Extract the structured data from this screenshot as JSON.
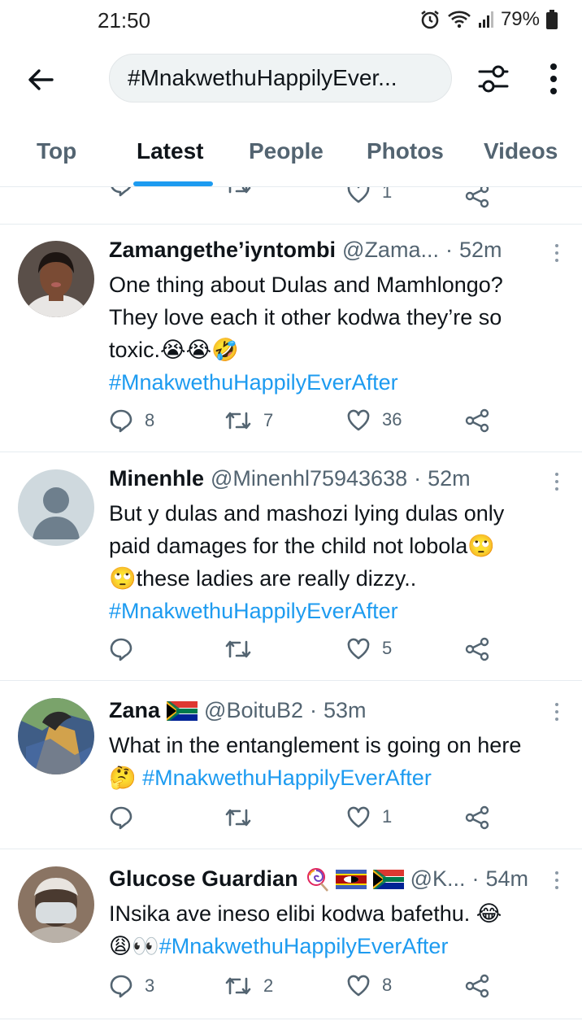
{
  "status_bar": {
    "time": "21:50",
    "battery": "79%"
  },
  "top_bar": {
    "search_query": "#MnakwethuHappilyEver..."
  },
  "tabs": [
    {
      "label": "Top"
    },
    {
      "label": "Latest"
    },
    {
      "label": "People"
    },
    {
      "label": "Photos"
    },
    {
      "label": "Videos"
    }
  ],
  "partial_tweet": {
    "likes": "1"
  },
  "tweets": [
    {
      "name": "Zamangethe’iyntombi",
      "handle": "@Zama...",
      "time": "52m",
      "text_lines": [
        "One thing about Dulas and Mamhlongo?",
        "They love each it other kodwa they’re so",
        "toxic.😭😭🤣"
      ],
      "hashtag": "#MnakwethuHappilyEverAfter",
      "replies": "8",
      "retweets": "7",
      "likes": "36"
    },
    {
      "name": "Minenhle",
      "handle": "@Minenhl75943638",
      "time": "52m",
      "text_lines": [
        "But y dulas and mashozi lying dulas only",
        "paid damages for the child not lobola🙄",
        "🙄these ladies are really dizzy.."
      ],
      "hashtag": "#MnakwethuHappilyEverAfter",
      "replies": "",
      "retweets": "",
      "likes": "5"
    },
    {
      "name": "Zana",
      "handle": "@BoituB2",
      "time": "53m",
      "text_lines": [
        "What in the entanglement is going on here",
        "🤔"
      ],
      "hashtag": "#MnakwethuHappilyEverAfter",
      "replies": "",
      "retweets": "",
      "likes": "1"
    },
    {
      "name": "Glucose Guardian",
      "handle": "@K...",
      "time": "54m",
      "text_lines": [
        "INsika ave ineso elibi kodwa bafethu. 😂",
        "😩👀"
      ],
      "hashtag": "#MnakwethuHappilyEverAfter",
      "replies": "3",
      "retweets": "2",
      "likes": "8"
    }
  ],
  "icons": {
    "back": "arrow-left-icon",
    "filter": "filter-sliders-icon",
    "more": "vertical-dots-icon",
    "reply": "reply-bubble-icon",
    "retweet": "retweet-icon",
    "like": "heart-icon",
    "share": "share-icon"
  },
  "colors": {
    "accent": "#1d9bf0",
    "text": "#0f1419",
    "muted": "#536471",
    "divider": "#e6ecf0"
  }
}
